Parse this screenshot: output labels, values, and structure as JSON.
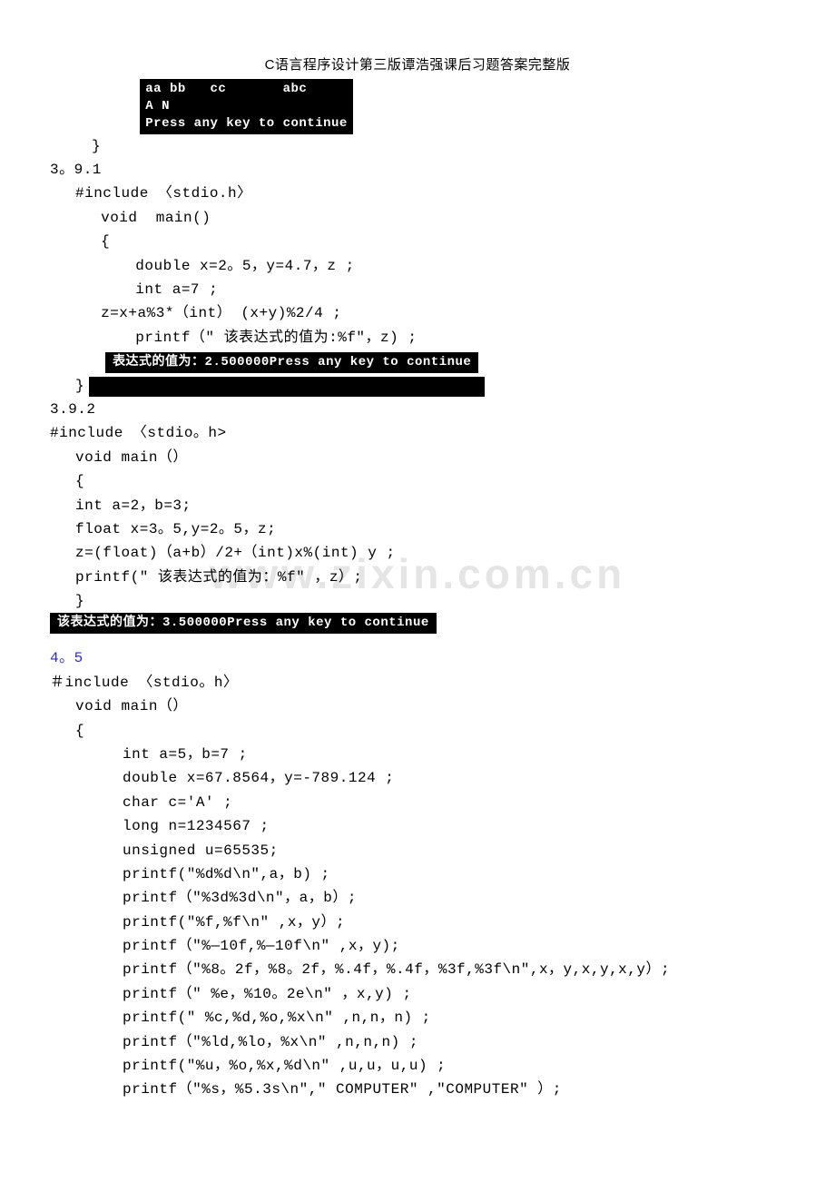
{
  "header": {
    "title": "C语言程序设计第三版谭浩强课后习题答案完整版"
  },
  "watermark": "www.zixin.com.cn",
  "console1": {
    "l1": "aa bb   cc       abc",
    "l2": "A N",
    "l3": "Press any key to continue"
  },
  "sec391": {
    "num": "3。9.1",
    "ln1": "#include 〈stdio.h〉",
    "ln2": " void  main()",
    "ln3": " {",
    "ln4": "   double x=2。5，y=4.7，z ;",
    "ln5": "   int a=7 ;",
    "ln6": " z=x+a%3*（int） (x+y)%2/4 ;",
    "ln7": "   printf（\" 该表达式的值为:%f\"，z) ;",
    "console": "表达式的值为：2.500000Press any key to continue",
    "ln8": "}"
  },
  "sec392": {
    "num": "3.9.2",
    "ln1": "#include 〈stdio。h>",
    "ln2": "void main（）",
    "ln3": "{",
    "ln4": "int a=2，b=3;",
    "ln5": "float x=3。5,y=2。5，z;",
    "ln6": "z=(float)（a+b）/2+（int)x%(int) y ;",
    "ln7": "printf(\" 该表达式的值为：%f\" ，z）;",
    "ln8": "}",
    "console": "该表达式的值为：3.500000Press any key to continue"
  },
  "sec45": {
    "num": "4。5",
    "ln1": "＃include 〈stdio。h〉",
    "ln2": "void main（）",
    "ln3": "{",
    "ln4": "int a=5，b=7 ;",
    "ln5": "double x=67.8564，y=-789.124 ;",
    "ln6": "char c='A' ;",
    "ln7": "long n=1234567 ;",
    "ln8": "unsigned u=65535;",
    "ln9": "printf(\"%d%d\\n\",a，b) ;",
    "ln10": "printf（\"%3d%3d\\n\"，a，b）;",
    "ln11": "printf(\"%f,%f\\n\" ,x，y）;",
    "ln12": "printf（\"%—10f,%—10f\\n\" ,x，y);",
    "ln13": "printf（\"%8。2f，%8。2f，%.4f，%.4f，%3f,%3f\\n\",x，y,x,y,x,y）;",
    "ln14": "printf（\" %e，%10。2e\\n\" ，x,y) ;",
    "ln15": "printf(\" %c,%d,%o,%x\\n\" ,n,n，n) ;",
    "ln16": "printf（\"%ld,%lo，%x\\n\" ,n,n,n) ;",
    "ln17": "printf(\"%u，%o,%x,%d\\n\" ,u,u，u,u) ;",
    "ln18": "printf（\"%s，%5.3s\\n\",\" COMPUTER\" ,\"COMPUTER\" ）;"
  }
}
